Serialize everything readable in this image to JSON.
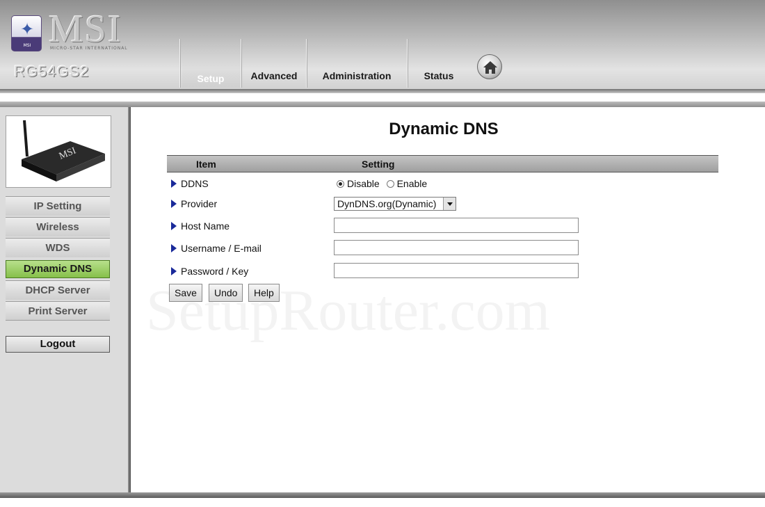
{
  "brand": {
    "logo_text": "MSI",
    "logo_subtext": "MICRO-STAR INTERNATIONAL",
    "badge_label": "MSI",
    "model": "RG54GS2"
  },
  "top_nav": {
    "tabs": [
      {
        "label": "Setup",
        "active": true
      },
      {
        "label": "Advanced",
        "active": false
      },
      {
        "label": "Administration",
        "active": false
      },
      {
        "label": "Status",
        "active": false
      }
    ],
    "home_icon": "home-icon"
  },
  "sidebar": {
    "device_image_label": "MSI",
    "items": [
      {
        "label": "IP Setting",
        "active": false
      },
      {
        "label": "Wireless",
        "active": false
      },
      {
        "label": "WDS",
        "active": false
      },
      {
        "label": "Dynamic DNS",
        "active": true
      },
      {
        "label": "DHCP Server",
        "active": false
      },
      {
        "label": "Print Server",
        "active": false
      }
    ],
    "logout_label": "Logout"
  },
  "main": {
    "title": "Dynamic DNS",
    "table": {
      "col_item": "Item",
      "col_setting": "Setting"
    },
    "ddns": {
      "label": "DDNS",
      "options": [
        "Disable",
        "Enable"
      ],
      "selected": "Disable"
    },
    "provider": {
      "label": "Provider",
      "value": "DynDNS.org(Dynamic)"
    },
    "host_name": {
      "label": "Host Name",
      "value": ""
    },
    "username": {
      "label": "Username / E-mail",
      "value": ""
    },
    "password": {
      "label": "Password / Key",
      "value": ""
    },
    "buttons": {
      "save": "Save",
      "undo": "Undo",
      "help": "Help"
    }
  },
  "watermark": "SetupRouter.com",
  "colors": {
    "active_nav": "#86c04a",
    "arrow": "#1a2a9a",
    "table_header": "#b0b0b0"
  }
}
